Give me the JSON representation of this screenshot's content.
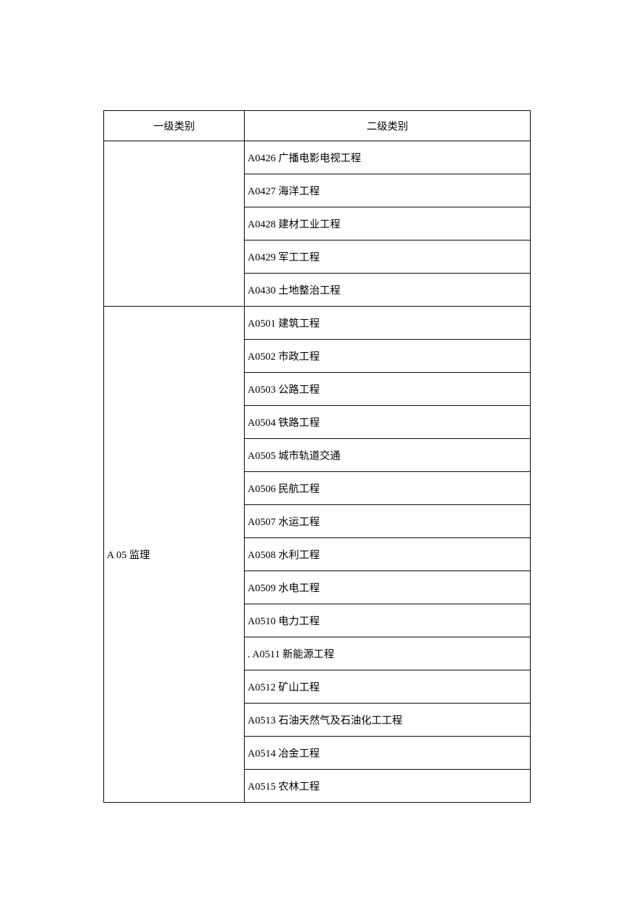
{
  "headers": {
    "level1": "一级类别",
    "level2": "二级类别"
  },
  "groups": [
    {
      "level1": "",
      "items": [
        "A0426 广播电影电视工程",
        "A0427 海洋工程",
        "A0428 建材工业工程",
        "A0429 军工工程",
        "A0430 土地整治工程"
      ]
    },
    {
      "level1": "A 05 监理",
      "items": [
        "A0501 建筑工程",
        "A0502 市政工程",
        "A0503 公路工程",
        "A0504 铁路工程",
        "A0505 城市轨道交通",
        "A0506 民航工程",
        "A0507 水运工程",
        "A0508 水利工程",
        "A0509 水电工程",
        "A0510 电力工程",
        ". A0511 新能源工程",
        "A0512 矿山工程",
        "A0513 石油天然气及石油化工工程",
        "A0514 冶金工程",
        "A0515 农林工程"
      ]
    }
  ]
}
